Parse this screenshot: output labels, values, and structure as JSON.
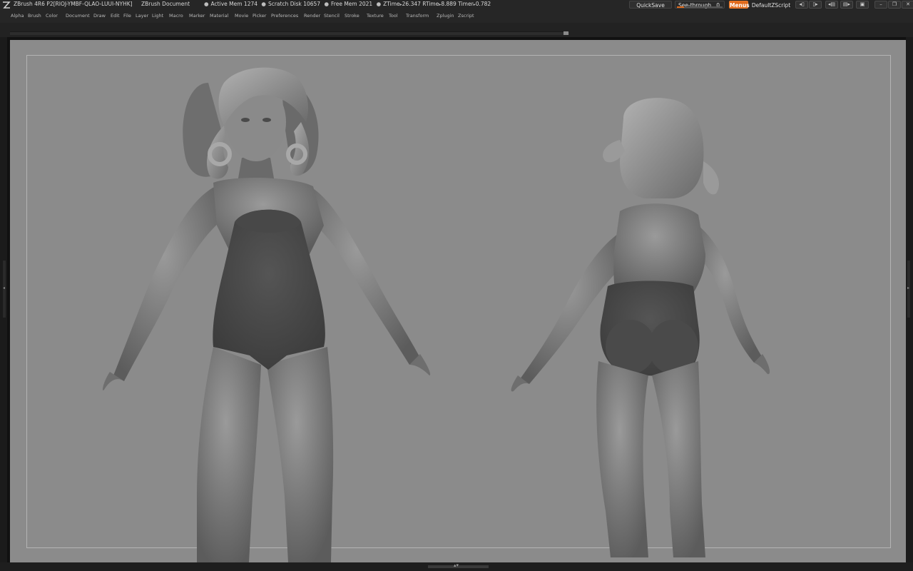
{
  "titlebar": {
    "app_version": "ZBrush 4R6 P2[RIOJ-YMBF-QLAO-LUUI-NYHK]",
    "document_name": "ZBrush Document",
    "stats": [
      {
        "label": "Active Mem",
        "value": "1274"
      },
      {
        "label": "Scratch Disk",
        "value": "10657"
      },
      {
        "label": "Free Mem",
        "value": "2021"
      }
    ],
    "timers": [
      {
        "label": "ZTime",
        "value": "26.347"
      },
      {
        "label": "RTime",
        "value": "8.889"
      },
      {
        "label": "Timer",
        "value": "0.782"
      }
    ],
    "quicksave_label": "QuickSave",
    "seethrough_label": "See-through",
    "seethrough_value": "0",
    "menus_label": "Menus",
    "default_zscript_label": "DefaultZScript"
  },
  "menubar": {
    "items": [
      "Alpha",
      "Brush",
      "Color",
      "Document",
      "Draw",
      "Edit",
      "File",
      "Layer",
      "Light",
      "Macro",
      "Marker",
      "Material",
      "Movie",
      "Picker",
      "Preferences",
      "Render",
      "Stencil",
      "Stroke",
      "Texture",
      "Tool",
      "Transform",
      "Zplugin",
      "Zscript"
    ]
  },
  "colors": {
    "accent": "#e06a1b",
    "canvas_background": "#8b8b8b",
    "ui_dark": "#262626"
  },
  "icons": {
    "app_logo": "zbrush-logo-icon",
    "window_controls": [
      "lock-icon",
      "minimize-icon",
      "restore-icon",
      "close-icon"
    ]
  }
}
